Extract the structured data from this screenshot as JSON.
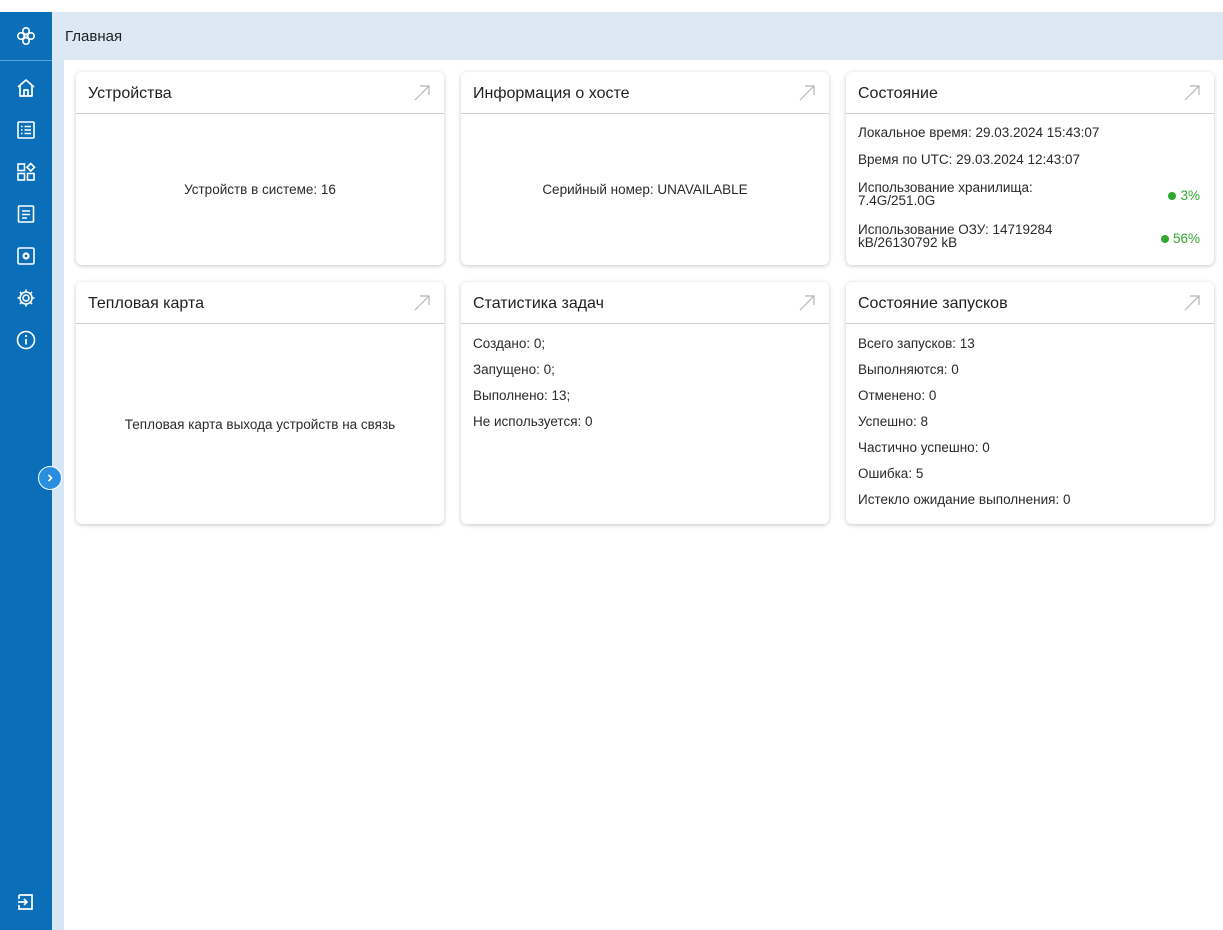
{
  "header": {
    "title": "Главная"
  },
  "sidebar": {
    "logo_icon": "app-logo-icon",
    "items": [
      {
        "name": "home",
        "icon": "home-icon"
      },
      {
        "name": "list",
        "icon": "list-icon"
      },
      {
        "name": "apps",
        "icon": "apps-icon"
      },
      {
        "name": "tasks",
        "icon": "document-icon"
      },
      {
        "name": "devices",
        "icon": "gear-box-icon"
      },
      {
        "name": "settings",
        "icon": "gear-icon"
      },
      {
        "name": "info",
        "icon": "info-icon"
      }
    ],
    "logout_icon": "logout-icon",
    "expand_icon": "chevron-right-icon"
  },
  "cards": {
    "devices": {
      "title": "Устройства",
      "text": "Устройств в системе: 16"
    },
    "host_info": {
      "title": "Информация о хосте",
      "text": "Серийный номер: UNAVAILABLE"
    },
    "status": {
      "title": "Состояние",
      "local_time": "Локальное время: 29.03.2024 15:43:07",
      "utc_time": "Время по UTC: 29.03.2024 12:43:07",
      "storage_label_1": "Использование хранилища:",
      "storage_label_2": "7.4G/251.0G",
      "storage_pct": "3%",
      "ram_label_1": "Использование ОЗУ: 14719284",
      "ram_label_2": "kB/26130792 kB",
      "ram_pct": "56%",
      "ok_color": "#2fa82f"
    },
    "heatmap": {
      "title": "Тепловая карта",
      "text": "Тепловая карта выхода устройств на связь"
    },
    "task_stats": {
      "title": "Статистика задач",
      "lines": [
        "Создано: 0;",
        "Запущено: 0;",
        "Выполнено: 13;",
        "Не используется: 0"
      ]
    },
    "launch_status": {
      "title": "Состояние запусков",
      "lines": [
        "Всего запусков: 13",
        "Выполняются: 0",
        "Отменено: 0",
        "Успешно: 8",
        "Частично успешно: 0",
        "Ошибка: 5",
        "Истекло ожидание выполнения: 0"
      ]
    }
  },
  "colors": {
    "sidebar": "#0a6fb8",
    "header": "#dce9f5",
    "accent": "#2a8ee0"
  }
}
